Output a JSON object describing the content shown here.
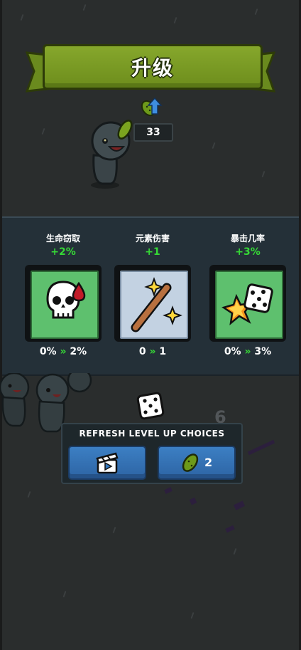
{
  "header": {
    "title": "升级",
    "pickle_count": "33"
  },
  "choices": [
    {
      "name": "生命窃取",
      "bonus": "+2%",
      "from": "0%",
      "to": "2%",
      "arrow": "»",
      "icon": "skull-blood-icon"
    },
    {
      "name": "元素伤害",
      "bonus": "+1",
      "from": "0",
      "to": "1",
      "arrow": "»",
      "icon": "magic-wand-icon"
    },
    {
      "name": "暴击几率",
      "bonus": "+3%",
      "from": "0%",
      "to": "3%",
      "arrow": "»",
      "icon": "crit-dice-icon"
    }
  ],
  "refresh": {
    "title": "REFRESH LEVEL UP CHOICES",
    "pickle_cost": "2"
  },
  "scene": {
    "floor_number": "6"
  },
  "colors": {
    "banner_green": "#7a9a26",
    "bonus_green": "#36d836",
    "panel_bg": "#243038",
    "button_blue": "#3477bb"
  }
}
